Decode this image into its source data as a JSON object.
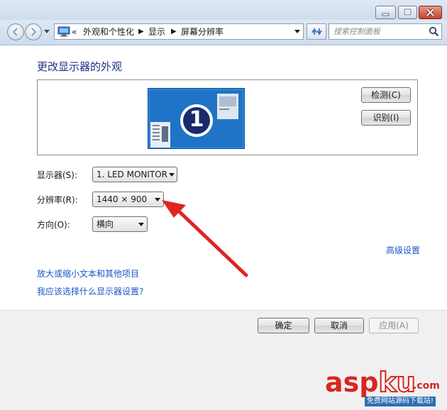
{
  "addressbar": {
    "crumb_prefix": "«",
    "crumbs": [
      "外观和个性化",
      "显示",
      "屏幕分辨率"
    ],
    "search_placeholder": "搜索控制面板"
  },
  "content": {
    "heading": "更改显示器的外观",
    "preview": {
      "monitor_number": "1",
      "detect_label": "检测(C)",
      "identify_label": "识别(I)"
    },
    "fields": {
      "display_label": "显示器(S):",
      "display_value": "1. LED MONITOR",
      "resolution_label": "分辨率(R):",
      "resolution_value": "1440 × 900",
      "orientation_label": "方向(O):",
      "orientation_value": "横向"
    },
    "advanced_link": "高级设置",
    "links": [
      "放大或缩小文本和其他项目",
      "我应该选择什么显示器设置?"
    ]
  },
  "footer": {
    "ok_label": "确定",
    "cancel_label": "取消",
    "apply_label": "应用(A)"
  },
  "watermark": {
    "main_a": "asp",
    "main_b": "ku",
    "suffix": ".com",
    "subtitle": "免费网站源码下载站!"
  },
  "colors": {
    "heading": "#1e3287",
    "link": "#1a55c8",
    "annotation_arrow": "#e02424",
    "watermark_red": "#d8261d"
  },
  "icons": {
    "back": "back-arrow-icon",
    "forward": "forward-arrow-icon",
    "refresh": "refresh-icon",
    "search": "search-icon",
    "control_panel": "control-panel-icon",
    "minimize": "minimize-icon",
    "maximize": "maximize-icon",
    "close": "close-icon"
  }
}
